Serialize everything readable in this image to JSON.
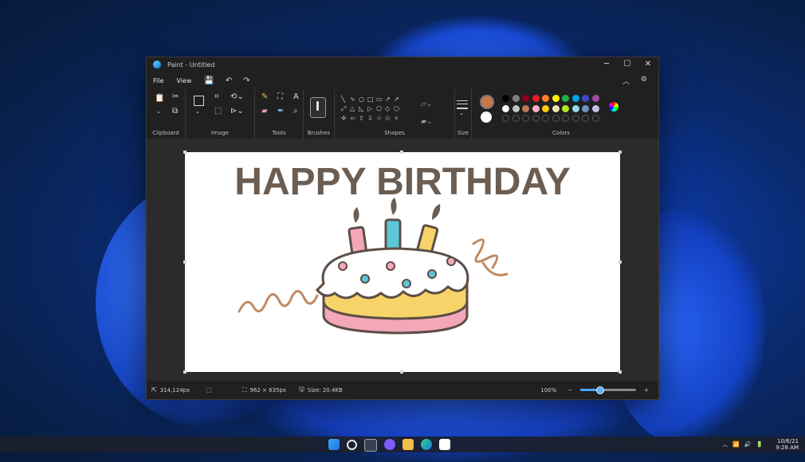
{
  "window": {
    "title": "Paint - Untitled",
    "controls": {
      "minimize": "─",
      "maximize": "☐",
      "close": "✕"
    }
  },
  "menu": {
    "file": "File",
    "view": "View",
    "save_icon": "💾",
    "undo_icon": "↶",
    "redo_icon": "↷",
    "collapse_icon": "︿",
    "settings_icon": "⚙"
  },
  "ribbon": {
    "groups": {
      "clipboard": "Clipboard",
      "image": "Image",
      "tools": "Tools",
      "brushes": "Brushes",
      "shapes": "Shapes",
      "size": "Size",
      "colors": "Colors"
    },
    "shapes_glyphs": [
      "╲",
      "∿",
      "○",
      "□",
      "▭",
      "↗",
      "↗",
      "⤢",
      "△",
      "◺",
      "▷",
      "⬠",
      "◇",
      "⬡",
      "✢",
      "⇦",
      "⇧",
      "⇩",
      "☆",
      "✩",
      "✧"
    ],
    "primary_color": "#c9764a",
    "secondary_color": "#ffffff",
    "palette_row1": [
      "#000000",
      "#7f7f7f",
      "#88001b",
      "#ec1c24",
      "#ff7f27",
      "#fff200",
      "#22b14c",
      "#00a2e8",
      "#3f48cc",
      "#a349a4"
    ],
    "palette_row2": [
      "#ffffff",
      "#c3c3c3",
      "#b97a57",
      "#ffaec9",
      "#ffc90e",
      "#efe4b0",
      "#b5e61d",
      "#99d9ea",
      "#7092be",
      "#c8bfe7"
    ]
  },
  "canvas": {
    "text": "HAPPY BIRTHDAY"
  },
  "status": {
    "cursor_icon": "⇱",
    "position": "314,124px",
    "selection_icon": "⬚",
    "dimension_icon": "⛶",
    "dimensions": "962 × 635px",
    "size_icon": "🖫",
    "size": "Size: 20.4KB",
    "zoom": "100%",
    "zoom_minus": "−",
    "zoom_plus": "+",
    "zoom_fraction": 0.35
  },
  "taskbar": {
    "tray_chevron": "︿",
    "wifi": "📶",
    "volume": "🔊",
    "battery": "🔋",
    "date": "10/6/21",
    "time": "9:28 AM"
  }
}
